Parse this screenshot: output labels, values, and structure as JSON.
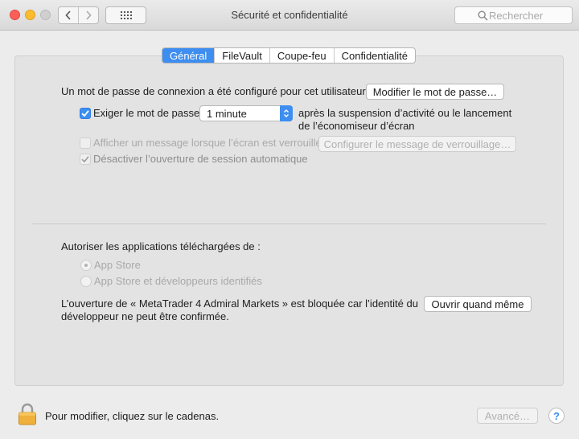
{
  "window": {
    "title": "Sécurité et confidentialité",
    "search_placeholder": "Rechercher"
  },
  "tabs": [
    {
      "label": "Général",
      "active": true
    },
    {
      "label": "FileVault",
      "active": false
    },
    {
      "label": "Coupe-feu",
      "active": false
    },
    {
      "label": "Confidentialité",
      "active": false
    }
  ],
  "general": {
    "password_set_text": "Un mot de passe de connexion a été configuré pour cet utilisateur",
    "change_password_button": "Modifier le mot de passe…",
    "require_password": {
      "label": "Exiger le mot de passe",
      "checked": true,
      "delay_value": "1 minute",
      "suffix_line1": "après la suspension d’activité ou le lancement",
      "suffix_line2": "de l’économiseur d’écran"
    },
    "lock_message": {
      "label": "Afficher un message lorsque l’écran est verrouillé",
      "checked": false,
      "button": "Configurer le message de verrouillage…"
    },
    "disable_autologin": {
      "label": "Désactiver l’ouverture de session automatique",
      "checked": true
    }
  },
  "downloads": {
    "heading": "Autoriser les applications téléchargées de :",
    "options": [
      {
        "label": "App Store",
        "selected": true
      },
      {
        "label": "App Store et développeurs identifiés",
        "selected": false
      }
    ],
    "blocked_line1": "L’ouverture de « MetaTrader 4 Admiral Markets » est bloquée car l’identité du",
    "blocked_line2": "développeur ne peut être confirmée.",
    "open_anyway_button": "Ouvrir quand même"
  },
  "footer": {
    "lock_text": "Pour modifier, cliquez sur le cadenas.",
    "advanced_button": "Avancé…",
    "help_label": "?"
  },
  "colors": {
    "accent": "#3d8ef0",
    "lock_gold": "#f0b03c"
  }
}
